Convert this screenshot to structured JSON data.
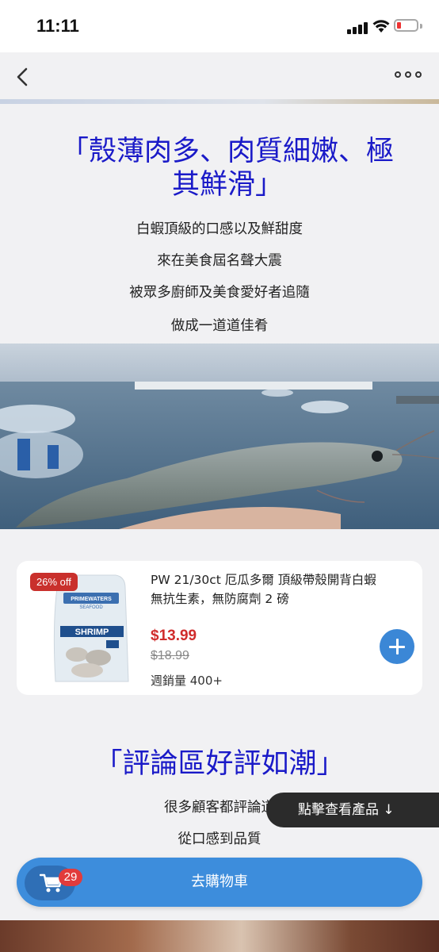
{
  "status": {
    "time": "11:11"
  },
  "content": {
    "heading1_line1": "「殼薄肉多、肉質細嫩、極",
    "heading1_line2": "其鮮滑」",
    "paragraphs": [
      "白蝦頂級的口感以及鮮甜度",
      "來在美食屆名聲大震",
      "被眾多廚師及美食愛好者追隨",
      "做成一道道佳肴"
    ],
    "heading2": "「評論區好評如潮」",
    "paragraphs2": [
      "很多顧客都評論道",
      "從口感到品質"
    ]
  },
  "product": {
    "discount": "26% off",
    "title_line1": "PW 21/30ct 厄瓜多爾 頂級帶殼開背白蝦",
    "title_line2": "無抗生素，無防腐劑 2 磅",
    "price": "$13.99",
    "old_price": "$18.99",
    "weekly_sales": "週銷量 400+",
    "package_label": "SHRIMP",
    "brand": "PRIMEWATERS SEAFOOD"
  },
  "toast": {
    "label": "點擊查看產品 ↓"
  },
  "cart": {
    "label": "去購物車",
    "count": "29"
  },
  "icons": {
    "back": "chevron-left-icon",
    "more": "more-dots-icon",
    "cart": "cart-icon",
    "add": "plus-icon"
  },
  "colors": {
    "heading": "#1a1ac8",
    "price": "#d02c2c",
    "accent": "#3d8ddc",
    "badge": "#c9302c"
  }
}
